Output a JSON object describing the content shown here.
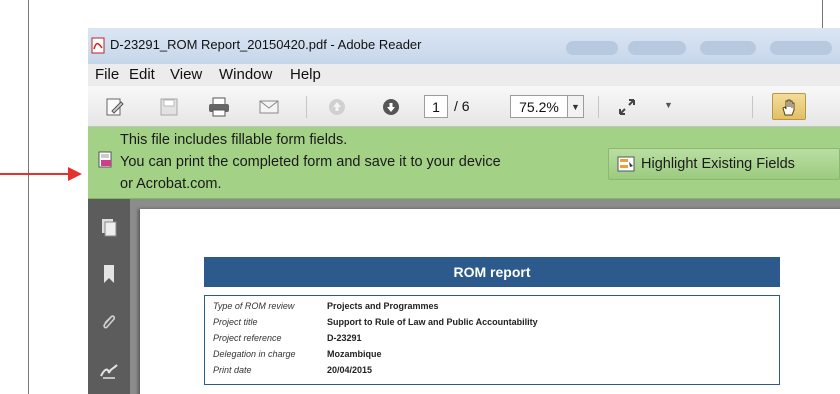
{
  "window": {
    "title": "D-23291_ROM Report_20150420.pdf - Adobe Reader"
  },
  "menu": {
    "items": [
      "File",
      "Edit",
      "View",
      "Window",
      "Help"
    ]
  },
  "toolbar": {
    "page_current": "1",
    "page_total": "/ 6",
    "zoom": "75.2%",
    "icons": [
      "edit-sign-icon",
      "save-icon",
      "print-icon",
      "email-icon",
      "previous-page-icon",
      "next-page-icon",
      "fit-page-icon",
      "hand-tool-icon"
    ]
  },
  "notification": {
    "lines": [
      "This file includes fillable form fields.",
      "You can print the completed form and save it to your device",
      "or Acrobat.com."
    ],
    "highlight_button": "Highlight Existing Fields"
  },
  "sidebar": {
    "icons": [
      "pages-icon",
      "bookmark-icon",
      "attachment-icon",
      "signature-icon"
    ]
  },
  "document": {
    "header": "ROM report",
    "rows": [
      {
        "label": "Type of ROM review",
        "value": "Projects and Programmes"
      },
      {
        "label": "Project title",
        "value": "Support to Rule of Law and Public Accountability"
      },
      {
        "label": "Project reference",
        "value": "D-23291"
      },
      {
        "label": "Delegation in charge",
        "value": "Mozambique"
      },
      {
        "label": "Print date",
        "value": "20/04/2015"
      }
    ]
  },
  "colors": {
    "notification_bg": "#a3d287",
    "doc_header_bg": "#2d5a8c",
    "annotation_arrow": "#e53030",
    "sidebar_bg": "#5c5c5c"
  }
}
